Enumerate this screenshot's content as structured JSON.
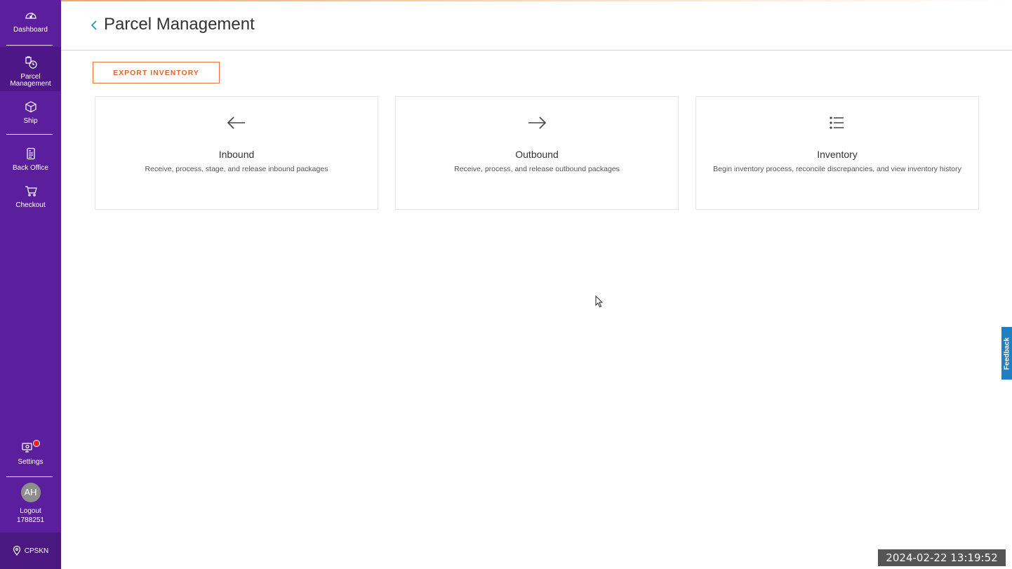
{
  "sidebar": {
    "items": [
      {
        "label": "Dashboard",
        "icon": "gauge-icon"
      },
      {
        "label": "Parcel\nManagement",
        "icon": "parcel-clock-icon"
      },
      {
        "label": "Ship",
        "icon": "box-icon"
      },
      {
        "label": "Back Office",
        "icon": "document-icon"
      },
      {
        "label": "Checkout",
        "icon": "cart-icon"
      },
      {
        "label": "Settings",
        "icon": "settings-monitor-icon"
      }
    ],
    "user": {
      "initials": "AH",
      "logout_label": "Logout",
      "user_id": "1788251"
    },
    "location": "CPSKN"
  },
  "header": {
    "title": "Parcel Management"
  },
  "toolbar": {
    "export_label": "EXPORT INVENTORY"
  },
  "cards": [
    {
      "title": "Inbound",
      "description": "Receive, process, stage, and release inbound packages",
      "icon": "arrow-left-icon"
    },
    {
      "title": "Outbound",
      "description": "Receive, process, and release outbound packages",
      "icon": "arrow-right-icon"
    },
    {
      "title": "Inventory",
      "description": "Begin inventory process, reconcile discrepancies, and view inventory history",
      "icon": "list-icon"
    }
  ],
  "feedback": {
    "label": "Feedback"
  },
  "timestamp": "2024-02-22  13:19:52",
  "colors": {
    "sidebar": "#5b1f9e",
    "accent": "#e8783a",
    "feedback": "#1f7fc0",
    "badge": "#e8202a"
  }
}
